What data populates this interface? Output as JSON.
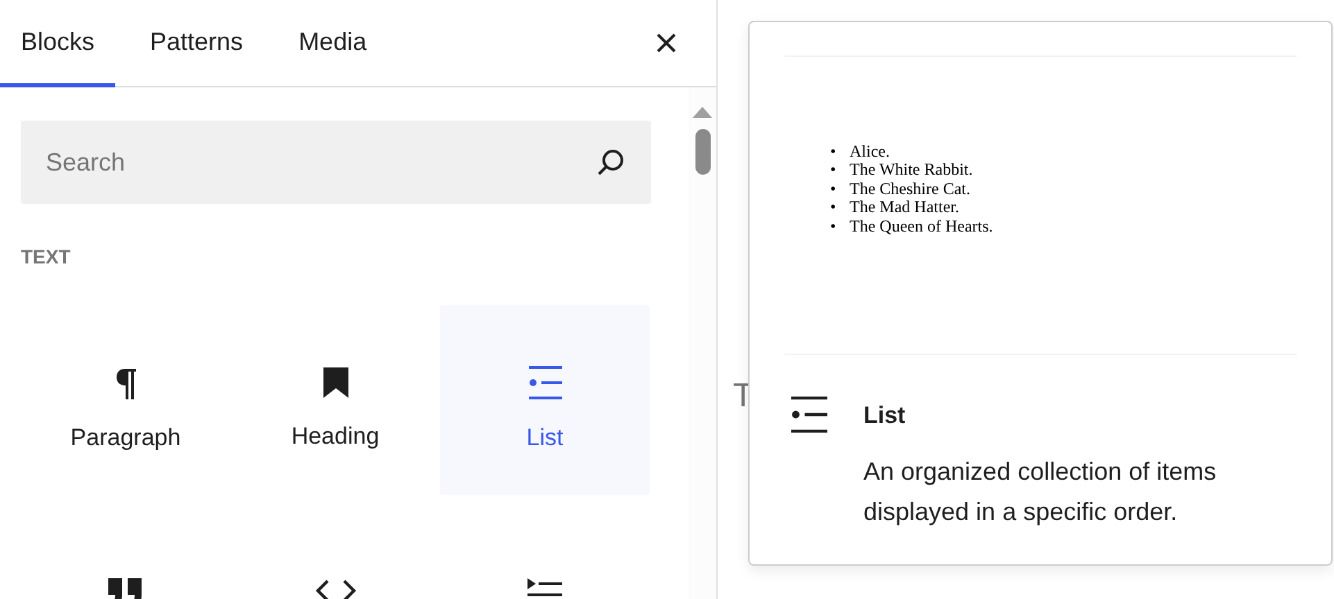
{
  "tabs": [
    {
      "label": "Blocks",
      "selected": true
    },
    {
      "label": "Patterns",
      "selected": false
    },
    {
      "label": "Media",
      "selected": false
    }
  ],
  "search": {
    "placeholder": "Search"
  },
  "category": "TEXT",
  "blocks": [
    {
      "label": "Paragraph",
      "selected": false
    },
    {
      "label": "Heading",
      "selected": false
    },
    {
      "label": "List",
      "selected": true
    },
    {
      "selected": false
    },
    {
      "selected": false
    },
    {
      "selected": false
    }
  ],
  "editor": {
    "texts": [
      "T"
    ]
  },
  "preview": {
    "marker": "•",
    "items": [
      "Alice.",
      "The White Rabbit.",
      "The Cheshire Cat.",
      "The Mad Hatter.",
      "The Queen of Hearts."
    ],
    "title": "List",
    "description": "An organized collection of items displayed in a specific order."
  }
}
